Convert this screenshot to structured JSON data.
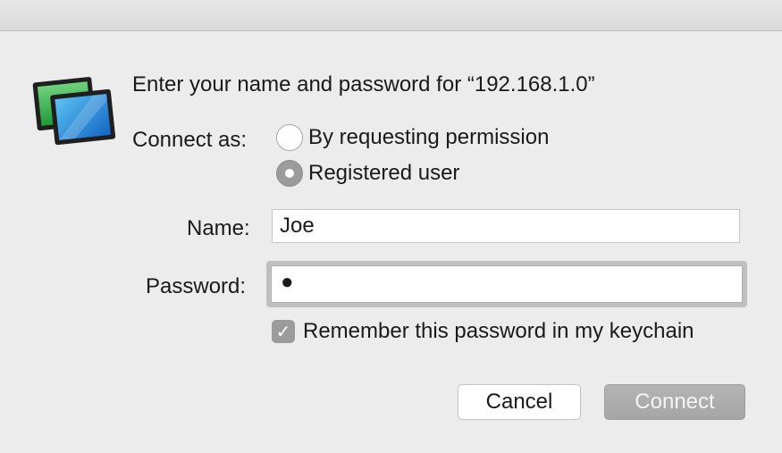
{
  "dialog": {
    "prompt": "Enter your name and password for “192.168.1.0”",
    "connect_as_label": "Connect as:",
    "options": [
      {
        "label": "By requesting permission",
        "selected": false
      },
      {
        "label": "Registered user",
        "selected": true
      }
    ],
    "name_label": "Name:",
    "name_value": "Joe",
    "password_label": "Password:",
    "password_mask": "●",
    "remember_label": "Remember this password in my keychain",
    "remember_checked": true,
    "cancel_label": "Cancel",
    "connect_label": "Connect",
    "icon": "screen-sharing-icon",
    "check_glyph": "✓"
  },
  "colors": {
    "background": "#ececec",
    "control_selected": "#9b9b9b",
    "connect_button": "#aaaaaa",
    "icon_green": "#35b24a",
    "icon_blue": "#1f7fd0"
  }
}
